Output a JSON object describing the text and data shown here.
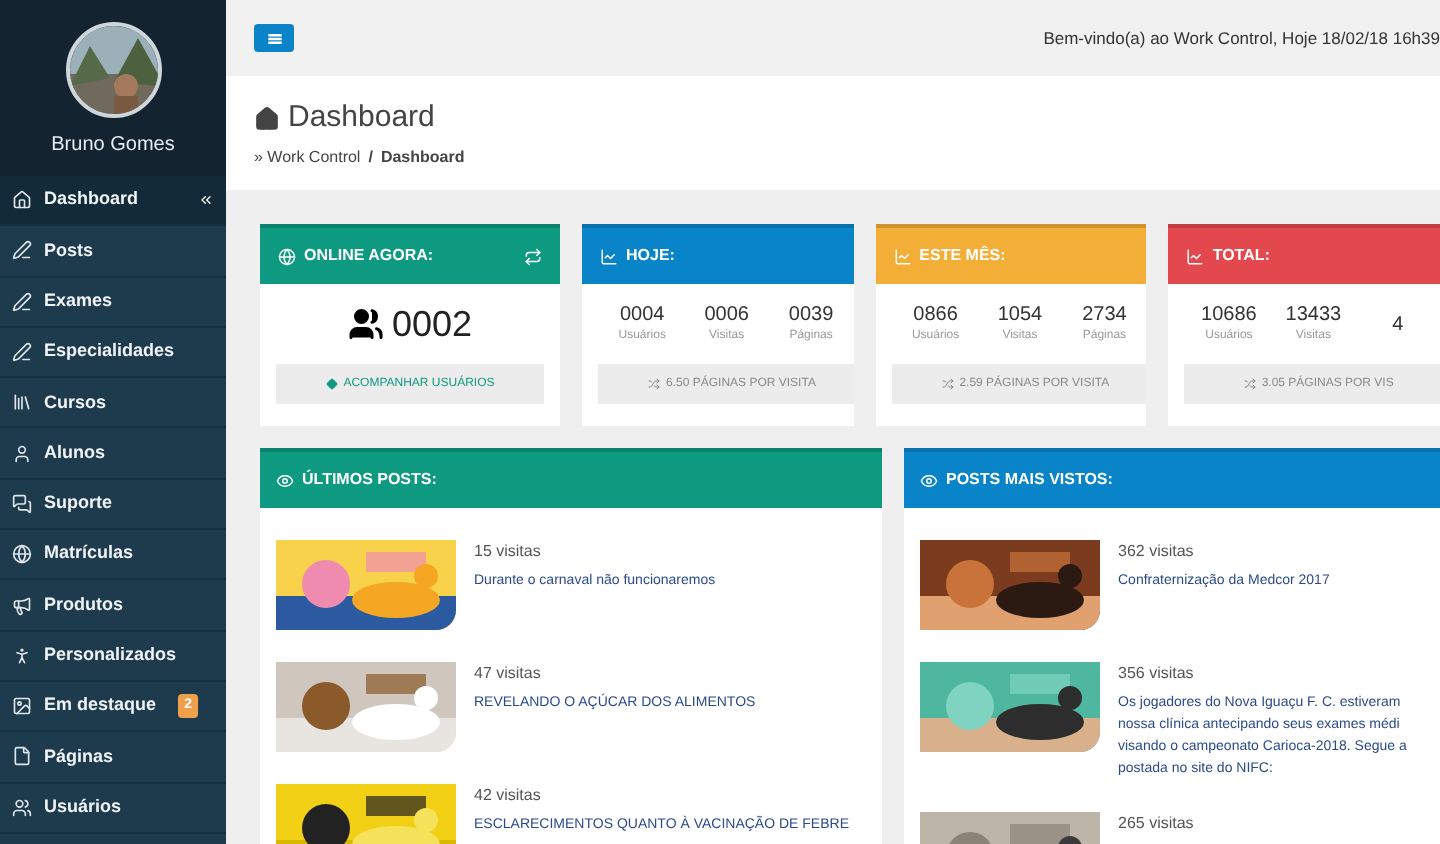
{
  "user": {
    "name": "Bruno Gomes"
  },
  "sidebar": {
    "items": [
      {
        "label": "Dashboard",
        "selected": true
      },
      {
        "label": "Posts",
        "selected": false
      },
      {
        "label": "Exames",
        "selected": false
      },
      {
        "label": "Especialidades",
        "selected": false
      },
      {
        "label": "Cursos",
        "selected": false
      },
      {
        "label": "Alunos",
        "selected": false
      },
      {
        "label": "Suporte",
        "selected": false
      },
      {
        "label": "Matrículas",
        "selected": false
      },
      {
        "label": "Produtos",
        "selected": false
      },
      {
        "label": "Personalizados",
        "selected": false
      },
      {
        "label": "Em destaque",
        "selected": false,
        "badge": "2"
      },
      {
        "label": "Páginas",
        "selected": false
      },
      {
        "label": "Usuários",
        "selected": false
      }
    ]
  },
  "topbar": {
    "welcome": "Bem-vindo(a) ao Work Control, Hoje 18/02/18 16h39"
  },
  "header": {
    "title": "Dashboard",
    "breadcrumb": [
      "» Work Control",
      "/",
      "Dashboard"
    ]
  },
  "stat_cards": [
    {
      "kind": "online",
      "title": "ONLINE AGORA:",
      "color": "#0e9a80",
      "count": "0002",
      "action": "ACOMPANHAR USUÁRIOS"
    },
    {
      "kind": "stats",
      "title": "HOJE:",
      "color": "#0a84c8",
      "stats": [
        {
          "value": "0004",
          "label": "Usuários"
        },
        {
          "value": "0006",
          "label": "Visitas"
        },
        {
          "value": "0039",
          "label": "Páginas"
        }
      ],
      "footer": "6.50 PÁGINAS POR VISITA"
    },
    {
      "kind": "stats",
      "title": "ESTE MÊS:",
      "color": "#f3ae38",
      "stats": [
        {
          "value": "0866",
          "label": "Usuários"
        },
        {
          "value": "1054",
          "label": "Visitas"
        },
        {
          "value": "2734",
          "label": "Páginas"
        }
      ],
      "footer": "2.59 PÁGINAS POR VISITA"
    },
    {
      "kind": "stats",
      "title": "TOTAL:",
      "color": "#e4484f",
      "stats": [
        {
          "value": "10686",
          "label": "Usuários"
        },
        {
          "value": "13433",
          "label": "Visitas"
        },
        {
          "value": "4"
        }
      ],
      "footer": "3.05 PÁGINAS POR VIS"
    }
  ],
  "post_panels": [
    {
      "title": "ÚLTIMOS POSTS:",
      "color": "#0e9a80",
      "posts": [
        {
          "views": "15 visitas",
          "title_lines": [
            "Durante o carnaval não funcionaremos"
          ]
        },
        {
          "views": "47 visitas",
          "title_lines": [
            "REVELANDO O AÇÚCAR DOS ALIMENTOS"
          ]
        },
        {
          "views": "42 visitas",
          "title_lines": [
            "ESCLARECIMENTOS QUANTO À VACINAÇÃO DE FEBRE"
          ]
        }
      ]
    },
    {
      "title": "POSTS MAIS VISTOS:",
      "color": "#0a84c8",
      "posts": [
        {
          "views": "362 visitas",
          "title_lines": [
            "Confraternização da Medcor 2017"
          ]
        },
        {
          "views": "356 visitas",
          "title_lines": [
            "Os jogadores do Nova Iguaçu F. C. estiveram",
            "nossa clínica antecipando seus exames médi",
            "visando o campeonato Carioca-2018. Segue a",
            "postada no site do NIFC:"
          ]
        },
        {
          "views": "265 visitas"
        }
      ]
    }
  ]
}
